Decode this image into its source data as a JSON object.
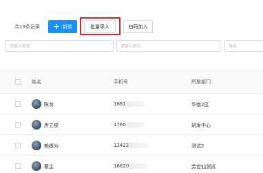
{
  "toolbar": {
    "record_count": "共19条记录",
    "add_button": {
      "icon": "plus-icon",
      "label": "新增"
    },
    "import_button": "批量导入",
    "scan_button": "扫码加入"
  },
  "filters": {
    "name_placeholder": "请输入昵称",
    "position_placeholder": "请输入职位",
    "role_placeholder": "角色"
  },
  "table": {
    "columns": {
      "name": "姓名",
      "phone": "手机号",
      "department": "所属部门"
    },
    "rows": [
      {
        "name": "陈龙",
        "phone": "1881",
        "department": "华南2区"
      },
      {
        "name": "房立俊",
        "phone": "1760",
        "department": "研发中心"
      },
      {
        "name": "赖振为",
        "phone": "13422",
        "department": "测试2"
      },
      {
        "name": "蔡主",
        "phone": "16620",
        "department": "劳世仙测试"
      }
    ]
  },
  "colors": {
    "primary": "#1890ff",
    "highlight": "#e02020"
  }
}
